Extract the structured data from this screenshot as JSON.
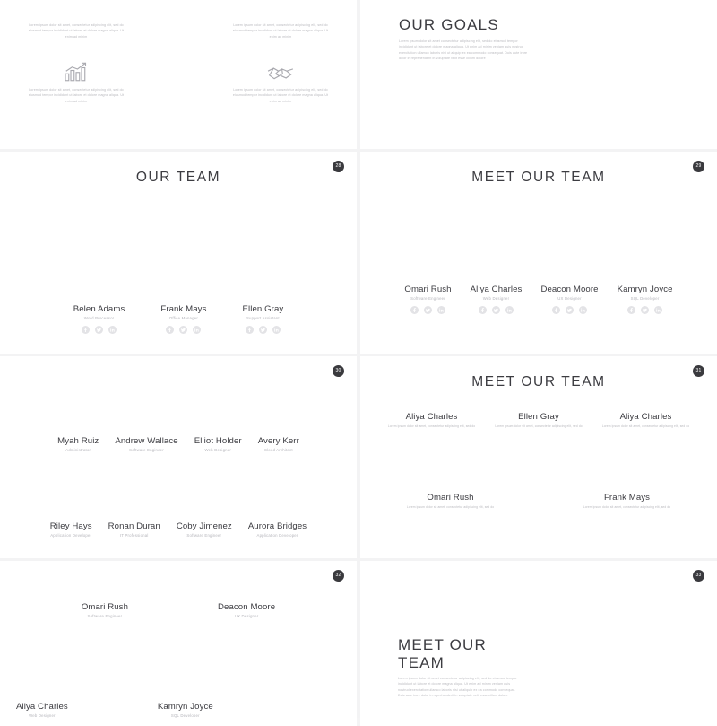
{
  "meta": {
    "deck_kind": "presentation-template-thumbnail-grid",
    "slide_count_visible": 8
  },
  "lorem": {
    "short_block": "Lorem ipsum dolor sit amet, consectetur adipiscing elit, sed do eiusmod tempor incididunt ut labore et dolore magna aliqua. Ut enim ad minim",
    "long_block": "Lorem ipsum dolor sit amet consectetur adipiscing elit, sed do eiusmod tempor incididunt ut labore et dolore magna aliqua. Ut enim ad minim veniam quis nostrud exercitation ullamco laboris nisi ut aliquip ex ea commodo consequat. Duis aute irure dolor in reprehenderit in voluptate velit esse cillum dolore",
    "card_block": "Lorem ipsum dolor sit amet, consectetur adipiscing elit, sed do"
  },
  "slides": [
    {
      "id": "slide-features",
      "page_number": "",
      "title": "",
      "columns": [
        {
          "icon": "bar-chart-growth-icon",
          "body": "Lorem ipsum dolor sit amet, consectetur adipiscing elit, sed do eiusmod tempor incididunt ut labore et dolore magna aliqua. Ut enim ad minim"
        },
        {
          "icon": "handshake-icon",
          "body": "Lorem ipsum dolor sit amet, consectetur adipiscing elit, sed do eiusmod tempor incididunt ut labore et dolore magna aliqua. Ut enim ad minim"
        }
      ],
      "top_columns": [
        {
          "body": "Lorem ipsum dolor sit amet, consectetur adipiscing elit, sed do eiusmod tempor incididunt ut labore et dolore magna aliqua. Ut enim ad minim"
        },
        {
          "body": "Lorem ipsum dolor sit amet, consectetur adipiscing elit, sed do eiusmod tempor incididunt ut labore et dolore magna aliqua. Ut enim ad minim"
        }
      ]
    },
    {
      "id": "slide-our-goals",
      "page_number": "",
      "title": "OUR GOALS",
      "body": "Lorem ipsum dolor sit amet consectetur adipiscing elit, sed do eiusmod tempor incididunt ut labore et dolore magna aliqua. Ut enim ad minim veniam quis nostrud exercitation ullamco laboris nisi ut aliquip ex ea commodo consequat. Duis aute irure dolor in reprehenderit in voluptate velit esse cillum dolore"
    },
    {
      "id": "slide-our-team",
      "page_number": "28",
      "title": "OUR TEAM",
      "members": [
        {
          "name": "Belen Adams",
          "role": "Word Processor",
          "socials": [
            "facebook-icon",
            "twitter-icon",
            "linkedin-icon"
          ]
        },
        {
          "name": "Frank Mays",
          "role": "Office Manager",
          "socials": [
            "facebook-icon",
            "twitter-icon",
            "linkedin-icon"
          ]
        },
        {
          "name": "Ellen Gray",
          "role": "Support Assistant",
          "socials": [
            "facebook-icon",
            "twitter-icon",
            "linkedin-icon"
          ]
        }
      ]
    },
    {
      "id": "slide-meet-our-team-4",
      "page_number": "29",
      "title": "MEET OUR TEAM",
      "members": [
        {
          "name": "Omari Rush",
          "role": "Software Engineer",
          "socials": [
            "facebook-icon",
            "twitter-icon",
            "linkedin-icon"
          ]
        },
        {
          "name": "Aliya Charles",
          "role": "Web Designer",
          "socials": [
            "facebook-icon",
            "twitter-icon",
            "linkedin-icon"
          ]
        },
        {
          "name": "Deacon Moore",
          "role": "UX Designer",
          "socials": [
            "facebook-icon",
            "twitter-icon",
            "linkedin-icon"
          ]
        },
        {
          "name": "Kamryn Joyce",
          "role": "SQL Developer",
          "socials": [
            "facebook-icon",
            "twitter-icon",
            "linkedin-icon"
          ]
        }
      ]
    },
    {
      "id": "slide-team-eight",
      "page_number": "30",
      "title": "",
      "row_one": [
        {
          "name": "Myah Ruiz",
          "role": "Administrator"
        },
        {
          "name": "Andrew Wallace",
          "role": "Software Engineer"
        },
        {
          "name": "Elliot Holder",
          "role": "Web Designer"
        },
        {
          "name": "Avery Kerr",
          "role": "Cloud Architect"
        }
      ],
      "row_two": [
        {
          "name": "Riley Hays",
          "role": "Application Developer"
        },
        {
          "name": "Ronan Duran",
          "role": "IT Professional"
        },
        {
          "name": "Coby Jimenez",
          "role": "Software Engineer"
        },
        {
          "name": "Aurora Bridges",
          "role": "Application Developer"
        }
      ]
    },
    {
      "id": "slide-meet-our-team-cards",
      "page_number": "31",
      "title": "MEET OUR TEAM",
      "row_one": [
        {
          "name": "Aliya Charles",
          "body": "Lorem ipsum dolor sit amet, consectetur adipiscing elit, sed do"
        },
        {
          "name": "Ellen Gray",
          "body": "Lorem ipsum dolor sit amet, consectetur adipiscing elit, sed do"
        },
        {
          "name": "Aliya Charles",
          "body": "Lorem ipsum dolor sit amet, consectetur adipiscing elit, sed do"
        }
      ],
      "row_two": [
        {
          "name": "Omari Rush",
          "body": "Lorem ipsum dolor sit amet, consectetur adipiscing elit, sed do"
        },
        {
          "name": "Frank Mays",
          "body": "Lorem ipsum dolor sit amet, consectetur adipiscing elit, sed do"
        }
      ]
    },
    {
      "id": "slide-team-quad",
      "page_number": "32",
      "title": "",
      "row_one": [
        {
          "name": "Omari Rush",
          "role": "Software Engineer"
        },
        {
          "name": "Deacon Moore",
          "role": "UX Designer"
        }
      ],
      "row_two": [
        {
          "name": "Aliya Charles",
          "role": "Web Designer"
        },
        {
          "name": "Kamryn Joyce",
          "role": "SQL Developer"
        }
      ]
    },
    {
      "id": "slide-meet-our-team-intro",
      "page_number": "33",
      "title": "MEET OUR TEAM",
      "body": "Lorem ipsum dolor sit amet consectetur adipiscing elit, sed do eiusmod tempor incididunt ut labore et dolore magna aliqua. Ut enim ad minim veniam quis nostrud exercitation ullamco laboris nisi ut aliquip ex ea commodo consequat. Duis aute irure dolor in reprehenderit in voluptate velit esse cillum dolore"
    }
  ],
  "colors": {
    "page_background": "#f3f3f4",
    "slide_background": "#ffffff",
    "heading": "#3c3c41",
    "body_text": "#b9b9be",
    "badge_background": "#3a3a3e",
    "social_chip": "#e3e3e6",
    "icon_stroke": "#a9a9af"
  }
}
